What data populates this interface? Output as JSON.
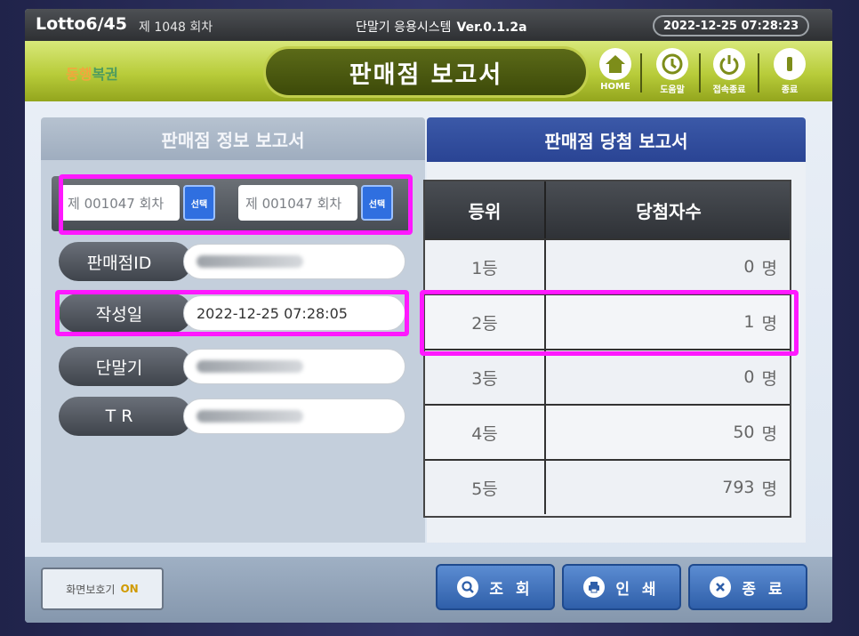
{
  "topbar": {
    "app_name": "Lotto6/45",
    "round": "제 1048 회차",
    "system_name": "단말기 응용시스템",
    "version": "Ver.0.1.2a",
    "datetime": "2022-12-25  07:28:23"
  },
  "header": {
    "logo_a": "동행",
    "logo_b": "복권",
    "title": "판매점 보고서",
    "buttons": [
      {
        "label": "HOME",
        "icon": "home-icon"
      },
      {
        "label": "도움말",
        "icon": "help-icon"
      },
      {
        "label": "접속종료",
        "icon": "power-icon"
      },
      {
        "label": "종료",
        "icon": "exit-icon"
      }
    ]
  },
  "tabs": {
    "left": "판매점 정보 보고서",
    "right": "판매점 당첨 보고서"
  },
  "selector": {
    "from_value": "제 001047 회차",
    "to_value": "제 001047 회차",
    "select_label": "선택",
    "dash": "-"
  },
  "fields": [
    {
      "label": "판매점ID",
      "value": ""
    },
    {
      "label": "작성일",
      "value": "2022-12-25  07:28:05"
    },
    {
      "label": "단말기",
      "value": ""
    },
    {
      "label": "T R",
      "value": ""
    }
  ],
  "winners": {
    "headers": [
      "등위",
      "당첨자수"
    ],
    "unit": "명",
    "rows": [
      {
        "rank": "1등",
        "count": "0"
      },
      {
        "rank": "2등",
        "count": "1"
      },
      {
        "rank": "3등",
        "count": "0"
      },
      {
        "rank": "4등",
        "count": "50"
      },
      {
        "rank": "5등",
        "count": "793"
      }
    ]
  },
  "bottom": {
    "saver_label": "화면보호기",
    "saver_state": "ON",
    "query": "조 회",
    "print": "인 쇄",
    "exit": "종 료"
  },
  "colors": {
    "highlight": "#ff18ff",
    "header_green": "#b8cc3a",
    "tab_blue": "#2a4494",
    "button_blue": "#2f5fa9"
  }
}
